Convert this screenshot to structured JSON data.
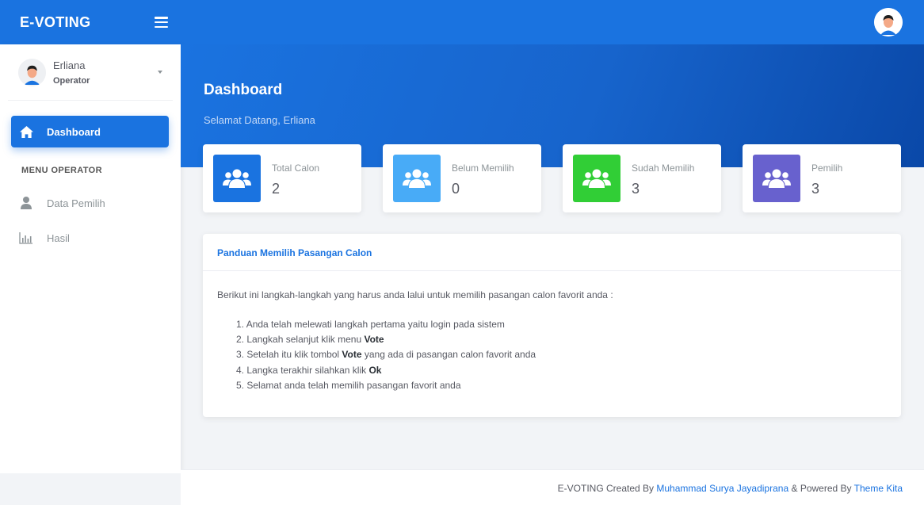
{
  "app": {
    "brand": "E-VOTING"
  },
  "user": {
    "name": "Erliana",
    "role": "Operator"
  },
  "nav": {
    "active": {
      "label": "Dashboard",
      "icon": "home-icon"
    },
    "section_title": "MENU OPERATOR",
    "items": [
      {
        "label": "Data Pemilih",
        "icon": "user-icon"
      },
      {
        "label": "Hasil",
        "icon": "bar-chart-icon"
      }
    ]
  },
  "header": {
    "title": "Dashboard",
    "subtitle": "Selamat Datang, Erliana"
  },
  "stats": [
    {
      "label": "Total Calon",
      "value": "2",
      "color": "#1a73e0",
      "icon": "users-icon"
    },
    {
      "label": "Belum Memilih",
      "value": "0",
      "color": "#48abf7",
      "icon": "users-icon"
    },
    {
      "label": "Sudah Memilih",
      "value": "3",
      "color": "#31ce36",
      "icon": "users-icon"
    },
    {
      "label": "Pemilih",
      "value": "3",
      "color": "#6861ce",
      "icon": "users-icon"
    }
  ],
  "guide": {
    "title": "Panduan Memilih Pasangan Calon",
    "intro": "Berikut ini langkah-langkah yang harus anda lalui untuk memilih pasangan calon favorit anda :",
    "steps": [
      {
        "num": "1.",
        "before": "Anda telah melewati langkah pertama yaitu login pada sistem",
        "bold": "",
        "after": ""
      },
      {
        "num": "2.",
        "before": "Langkah selanjut klik menu ",
        "bold": "Vote",
        "after": ""
      },
      {
        "num": "3.",
        "before": "Setelah itu klik tombol ",
        "bold": "Vote",
        "after": " yang ada di pasangan calon favorit anda"
      },
      {
        "num": "4.",
        "before": "Langka terakhir silahkan klik ",
        "bold": "Ok",
        "after": ""
      },
      {
        "num": "5.",
        "before": "Selamat anda telah memilih pasangan favorit anda",
        "bold": "",
        "after": ""
      }
    ]
  },
  "footer": {
    "prefix": "E-VOTING Created By ",
    "author": "Muhammad Surya Jayadiprana",
    "middle": " & Powered By ",
    "theme": "Theme Kita"
  },
  "colors": {
    "primary": "#1a73e0",
    "accent_light": "#48abf7",
    "success": "#31ce36",
    "purple": "#6861ce"
  }
}
